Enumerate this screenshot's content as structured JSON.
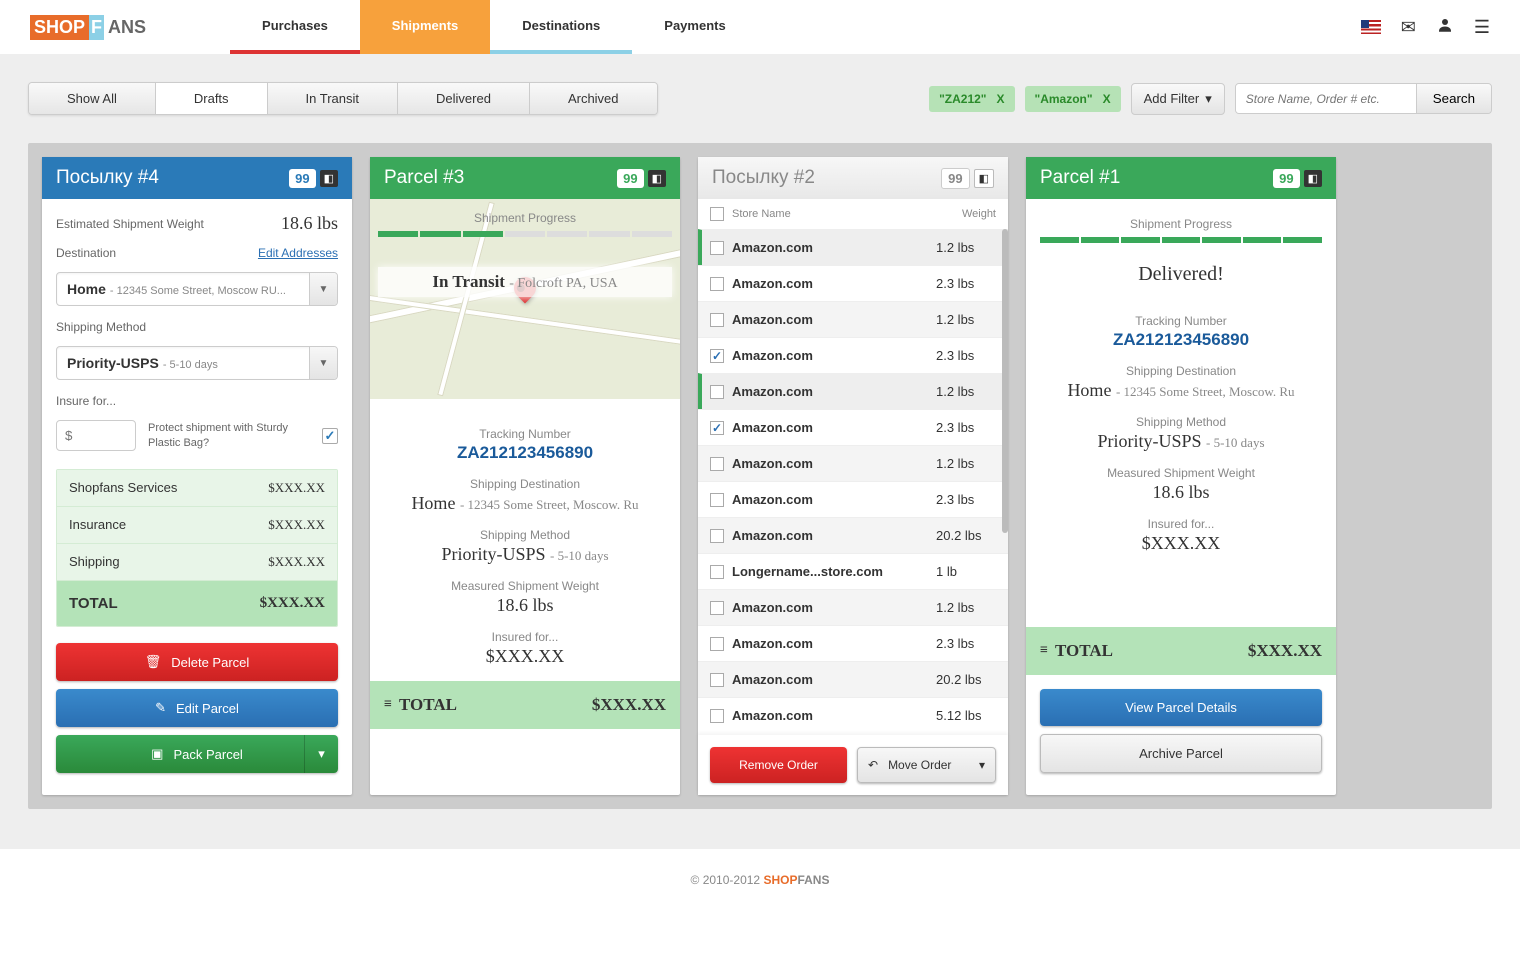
{
  "nav": {
    "purchases": "Purchases",
    "shipments": "Shipments",
    "destinations": "Destinations",
    "payments": "Payments"
  },
  "logo": {
    "shop": "SHOP",
    "f": "F",
    "ans": "ANS"
  },
  "tabs": {
    "show_all": "Show All",
    "drafts": "Drafts",
    "in_transit": "In Transit",
    "delivered": "Delivered",
    "archived": "Archived"
  },
  "filters": {
    "tag1": "\"ZA212\"",
    "tag2": "\"Amazon\"",
    "x": "X",
    "add": "Add Filter",
    "search_ph": "Store Name, Order # etc.",
    "search_btn": "Search"
  },
  "col4": {
    "title": "Посылку #4",
    "badge": "99",
    "est_label": "Estimated Shipment Weight",
    "est_value": "18.6 lbs",
    "dest_label": "Destination",
    "edit_addr": "Edit Addresses",
    "home": "Home",
    "home_sub": "- 12345 Some Street, Moscow RU...",
    "method_label": "Shipping Method",
    "method_main": "Priority-USPS",
    "method_sub": "- 5-10 days",
    "insure_label": "Insure for...",
    "dollar": "$",
    "protect": "Protect shipment with Sturdy Plastic Bag?",
    "p1": "Shopfans Services",
    "a1": "$XXX.XX",
    "p2": "Insurance",
    "a2": "$XXX.XX",
    "p3": "Shipping",
    "a3": "$XXX.XX",
    "total": "TOTAL",
    "at": "$XXX.XX",
    "btn_del": "Delete Parcel",
    "btn_edit": "Edit Parcel",
    "btn_pack": "Pack Parcel"
  },
  "col3": {
    "title": "Parcel #3",
    "badge": "99",
    "progress_label": "Shipment Progress",
    "map_status": "In Transit",
    "map_loc": "- Folcroft PA, USA",
    "track_lbl": "Tracking Number",
    "track_val": "ZA212123456890",
    "dest_lbl": "Shipping Destination",
    "dest_main": "Home",
    "dest_sub": "- 12345 Some Street, Moscow. Ru",
    "method_lbl": "Shipping Method",
    "method_main": "Priority-USPS",
    "method_sub": "- 5-10 days",
    "weight_lbl": "Measured Shipment Weight",
    "weight_val": "18.6 lbs",
    "insure_lbl": "Insured for...",
    "insure_val": "$XXX.XX",
    "total": "TOTAL",
    "total_amt": "$XXX.XX"
  },
  "col2": {
    "title": "Посылку #2",
    "badge": "99",
    "h_store": "Store Name",
    "h_weight": "Weight",
    "rows": [
      {
        "name": "Amazon.com",
        "wt": "1.2 lbs",
        "checked": false,
        "hl": true
      },
      {
        "name": "Amazon.com",
        "wt": "2.3 lbs",
        "checked": false,
        "hl": false
      },
      {
        "name": "Amazon.com",
        "wt": "1.2 lbs",
        "checked": false,
        "hl": false
      },
      {
        "name": "Amazon.com",
        "wt": "2.3 lbs",
        "checked": true,
        "hl": false
      },
      {
        "name": "Amazon.com",
        "wt": "1.2 lbs",
        "checked": false,
        "hl": true
      },
      {
        "name": "Amazon.com",
        "wt": "2.3 lbs",
        "checked": true,
        "hl": false
      },
      {
        "name": "Amazon.com",
        "wt": "1.2 lbs",
        "checked": false,
        "hl": false
      },
      {
        "name": "Amazon.com",
        "wt": "2.3 lbs",
        "checked": false,
        "hl": false
      },
      {
        "name": "Amazon.com",
        "wt": "20.2 lbs",
        "checked": false,
        "hl": false
      },
      {
        "name": "Longername...store.com",
        "wt": "1 lb",
        "checked": false,
        "hl": false
      },
      {
        "name": "Amazon.com",
        "wt": "1.2 lbs",
        "checked": false,
        "hl": false
      },
      {
        "name": "Amazon.com",
        "wt": "2.3 lbs",
        "checked": false,
        "hl": false
      },
      {
        "name": "Amazon.com",
        "wt": "20.2 lbs",
        "checked": false,
        "hl": false
      },
      {
        "name": "Amazon.com",
        "wt": "5.12 lbs",
        "checked": false,
        "hl": false
      }
    ],
    "btn_remove": "Remove Order",
    "btn_move": "Move Order"
  },
  "col1": {
    "title": "Parcel #1",
    "badge": "99",
    "progress_label": "Shipment Progress",
    "delivered": "Delivered!",
    "track_lbl": "Tracking Number",
    "track_val": "ZA212123456890",
    "dest_lbl": "Shipping Destination",
    "dest_main": "Home",
    "dest_sub": "- 12345 Some Street, Moscow. Ru",
    "method_lbl": "Shipping Method",
    "method_main": "Priority-USPS",
    "method_sub": "- 5-10 days",
    "weight_lbl": "Measured Shipment Weight",
    "weight_val": "18.6 lbs",
    "insure_lbl": "Insured for...",
    "insure_val": "$XXX.XX",
    "total": "TOTAL",
    "total_amt": "$XXX.XX",
    "btn_view": "View Parcel Details",
    "btn_archive": "Archive Parcel"
  },
  "footer": {
    "copy": "© 2010-2012 ",
    "shop": "SHOP",
    "fans": "FANS"
  }
}
